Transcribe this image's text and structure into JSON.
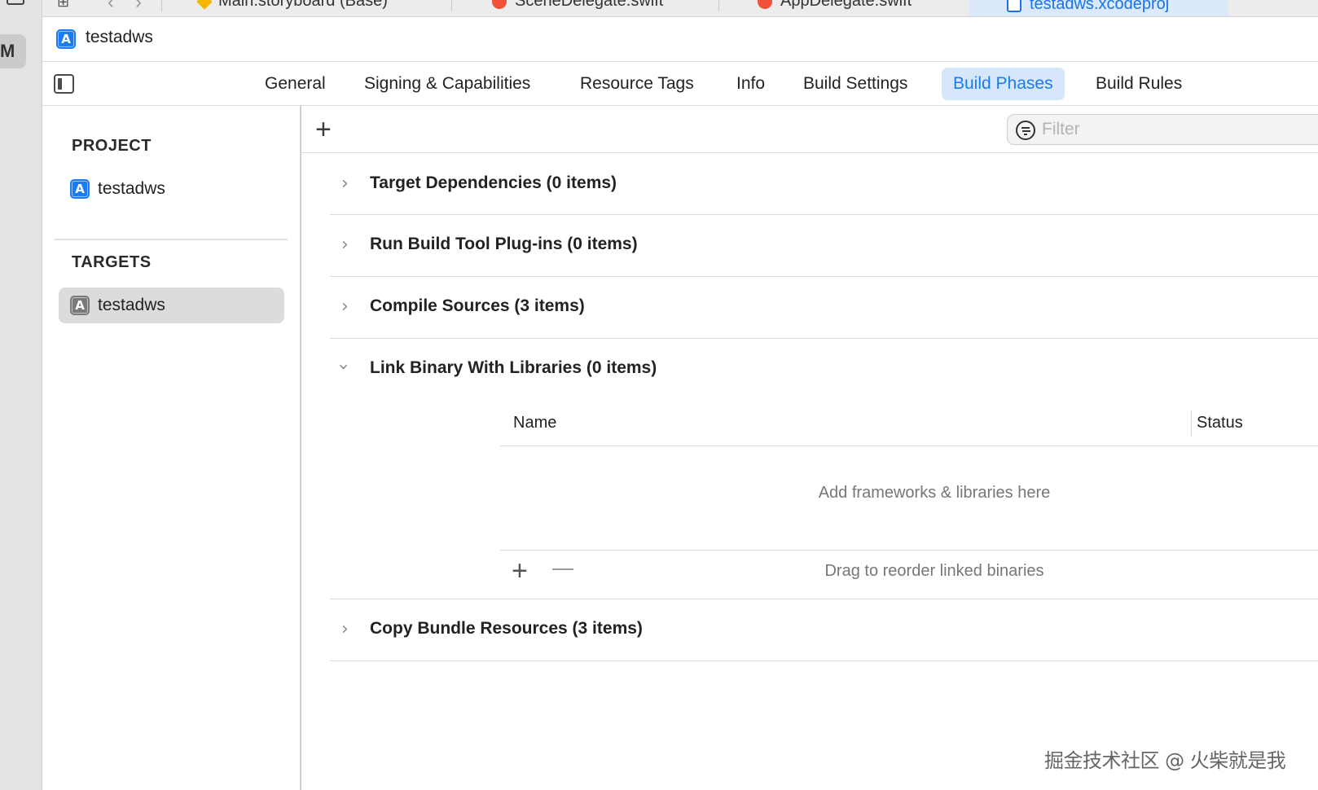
{
  "tabbar": {
    "tabs": [
      {
        "label": "Main.storyboard (Base)",
        "icon": "storyboard-icon",
        "color": "#f2b705"
      },
      {
        "label": "SceneDelegate.swift",
        "icon": "swift-icon",
        "color": "#f05138"
      },
      {
        "label": "AppDelegate.swift",
        "icon": "swift-icon",
        "color": "#f05138"
      },
      {
        "label": "testadws.xcodeproj",
        "icon": "xcodeproj-icon",
        "color": "#1a73e8"
      }
    ]
  },
  "left_strip": {
    "label": "M"
  },
  "header": {
    "title": "testadws"
  },
  "editor_tabs": [
    {
      "label": "General"
    },
    {
      "label": "Signing & Capabilities"
    },
    {
      "label": "Resource Tags"
    },
    {
      "label": "Info"
    },
    {
      "label": "Build Settings"
    },
    {
      "label": "Build Phases",
      "active": true
    },
    {
      "label": "Build Rules"
    }
  ],
  "navigator": {
    "project_heading": "PROJECT",
    "project_item": "testadws",
    "targets_heading": "TARGETS",
    "target_item": "testadws"
  },
  "toolbar": {
    "add_label": "+",
    "filter_placeholder": "Filter"
  },
  "phases": [
    {
      "title": "Target Dependencies (0 items)",
      "expanded": false
    },
    {
      "title": "Run Build Tool Plug-ins (0 items)",
      "expanded": false
    },
    {
      "title": "Compile Sources (3 items)",
      "expanded": false
    },
    {
      "title": "Link Binary With Libraries (0 items)",
      "expanded": true
    },
    {
      "title": "Copy Bundle Resources (3 items)",
      "expanded": false
    }
  ],
  "link_table": {
    "col_name": "Name",
    "col_status": "Status",
    "empty_text": "Add frameworks & libraries here",
    "add_label": "+",
    "hint": "Drag to reorder linked binaries"
  },
  "watermark": "掘金技术社区 @ 火柴就是我",
  "colors": {
    "accent": "#1a7cf0",
    "active_tab_bg": "#d6e7fb",
    "selected_row_bg": "#dcdcdc"
  }
}
